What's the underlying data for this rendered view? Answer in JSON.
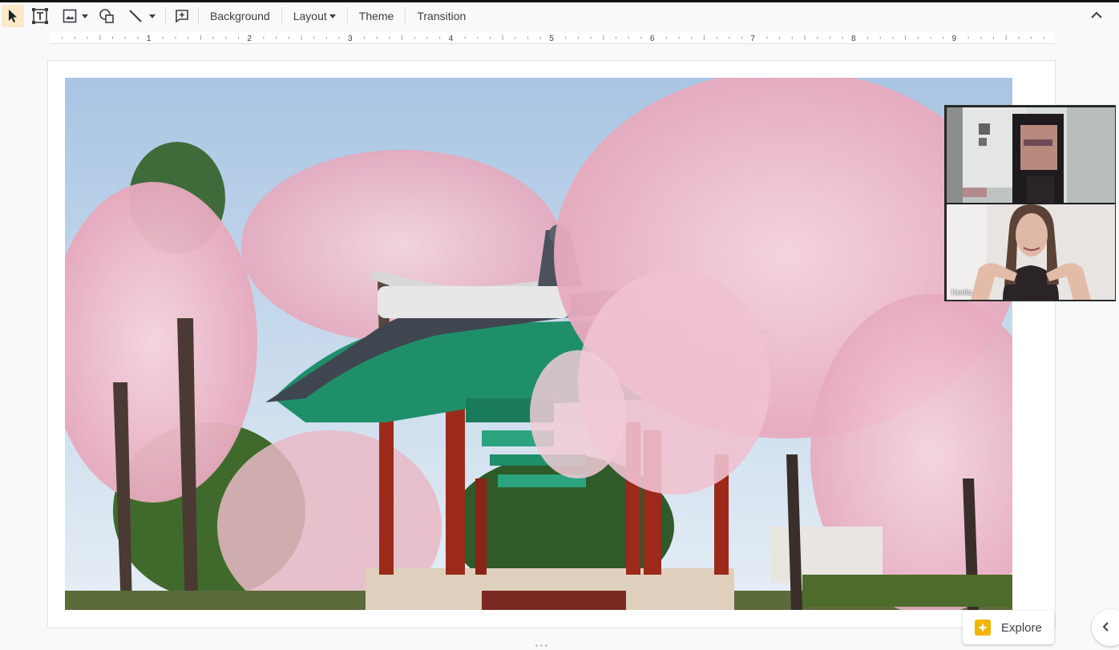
{
  "toolbar": {
    "tools": [
      "select-tool",
      "text-box-tool",
      "image-tool",
      "shape-tool",
      "line-tool",
      "comment-tool"
    ],
    "background_label": "Background",
    "layout_label": "Layout",
    "theme_label": "Theme",
    "transition_label": "Transition"
  },
  "ruler": {
    "numbers": [
      "1",
      "2",
      "3",
      "4",
      "5",
      "6",
      "7",
      "8",
      "9"
    ]
  },
  "slide": {
    "image_subject": "pavilion-with-cherry-blossoms-photo"
  },
  "video_call": {
    "participants": [
      {
        "name": "",
        "pixelated": true
      },
      {
        "name": "Keela",
        "pixelated": false
      }
    ]
  },
  "explore": {
    "label": "Explore"
  },
  "colors": {
    "accent": "#fbe9c8",
    "explore_icon": "#f4b400",
    "pavilion_green": "#1f8f6a",
    "pavilion_red": "#9b2a1b",
    "blossom": "#f2c2d1"
  }
}
